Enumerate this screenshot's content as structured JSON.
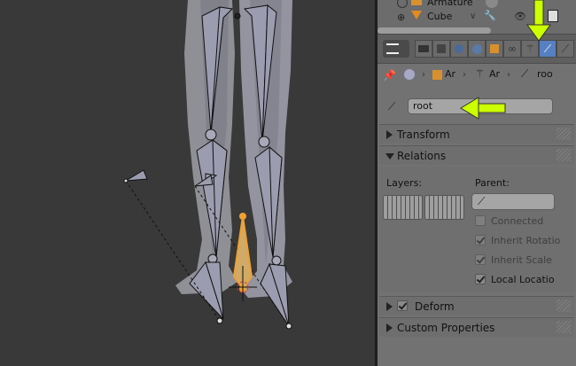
{
  "outliner": {
    "items": [
      {
        "label": "Armature",
        "icon": "armature-icon"
      },
      {
        "label": "Cube",
        "icon": "mesh-icon"
      }
    ]
  },
  "properties": {
    "tabs": [
      "render-tab",
      "render-layers-tab",
      "scene-tab",
      "world-tab",
      "object-tab",
      "constraints-tab",
      "object-data-tab",
      "bone-tab",
      "bone-constraints-tab"
    ],
    "active_tab": "bone-tab",
    "breadcrumb": [
      "Ar",
      "Ar",
      "roo"
    ],
    "bone_name": "root",
    "sections": {
      "transform": "Transform",
      "relations": "Relations",
      "deform": "Deform",
      "custom_properties": "Custom Properties"
    },
    "relations": {
      "layers_label": "Layers:",
      "parent_label": "Parent:",
      "connected": "Connected",
      "inherit_rotation": "Inherit Rotatio",
      "inherit_scale": "Inherit Scale",
      "local_location": "Local Locatio"
    }
  },
  "colors": {
    "viewport_bg": "#393939",
    "panel_bg": "#727272",
    "active_tab": "#5680c2",
    "annotation_arrow": "#ccff00",
    "selected_bone": "#f0a030"
  }
}
